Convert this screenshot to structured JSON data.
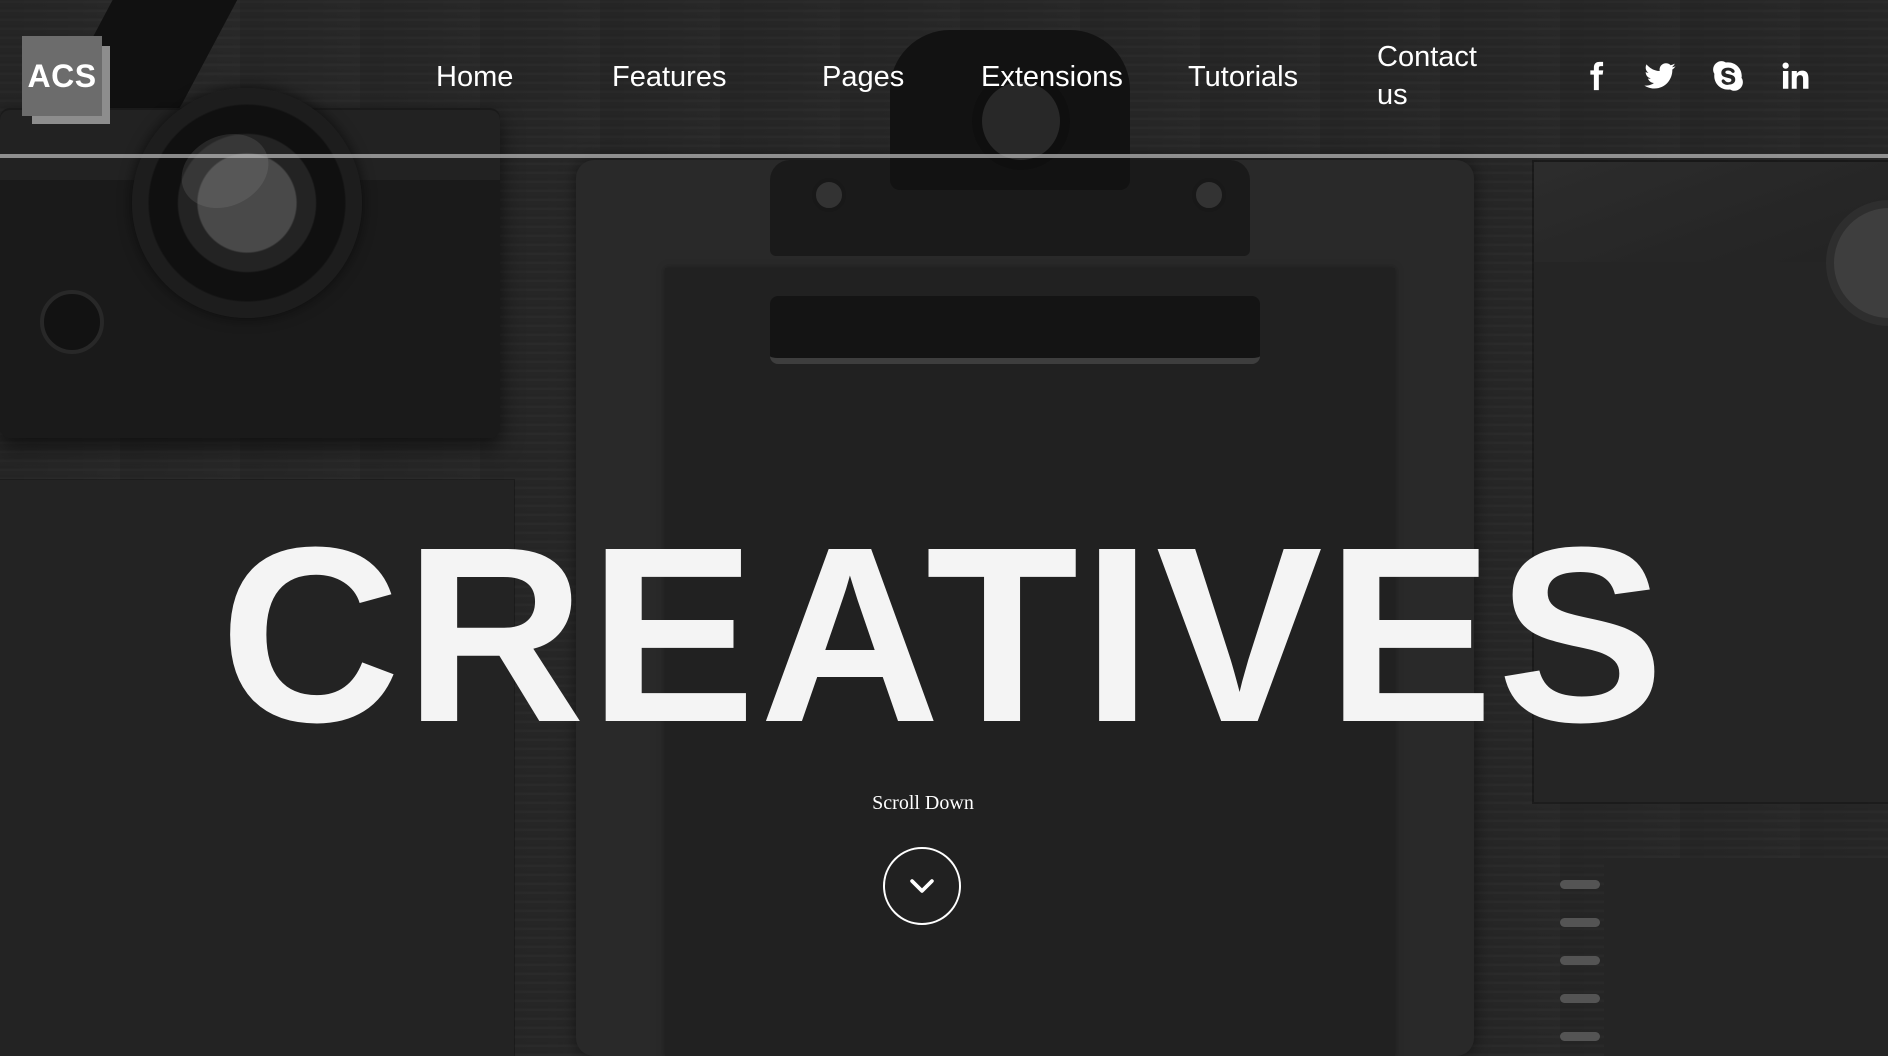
{
  "logo": {
    "text": "ACS"
  },
  "nav": {
    "items": [
      {
        "label": "Home"
      },
      {
        "label": "Features"
      },
      {
        "label": "Pages"
      },
      {
        "label": "Extensions"
      },
      {
        "label": "Tutorials"
      },
      {
        "label": "Contact us"
      }
    ]
  },
  "social": {
    "icons": [
      "facebook-icon",
      "twitter-icon",
      "skype-icon",
      "linkedin-icon"
    ]
  },
  "hero": {
    "title": "CREATIVES",
    "scroll_label": "Scroll Down",
    "scroll_icon": "chevron-down-icon"
  },
  "colors": {
    "text": "#ffffff",
    "logo_bg": "#6c6c6c",
    "logo_shadow": "#8d8d8d",
    "background": "#2a2a2a",
    "divider": "#bebebe"
  }
}
